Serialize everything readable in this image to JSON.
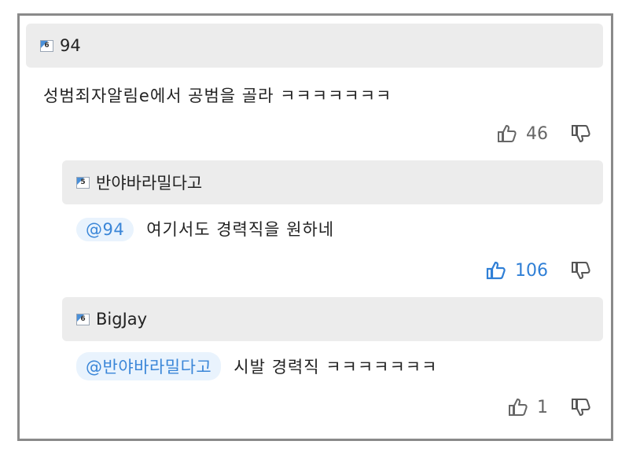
{
  "comments": [
    {
      "level": "6",
      "nickname": "94",
      "mention": "",
      "text": "성범죄자알림e에서 공범을 골라 ㅋㅋㅋㅋㅋㅋㅋ",
      "likes": "46",
      "liked": false
    },
    {
      "level": "5",
      "nickname": "반야바라밀다고",
      "mention": "@94",
      "text": "여기서도 경력직을 원하네",
      "likes": "106",
      "liked": true
    },
    {
      "level": "6",
      "nickname": "BigJay",
      "mention": "@반야바라밀다고",
      "text": "시발 경력직 ㅋㅋㅋㅋㅋㅋㅋ",
      "likes": "1",
      "liked": false
    }
  ],
  "icons": {
    "like": "thumbs-up-icon",
    "dislike": "thumbs-down-icon",
    "level": "level-badge-icon"
  },
  "colors": {
    "accent": "#2f7fd6",
    "header_bg": "#ececec",
    "mention_bg": "#e9f3fd",
    "border": "#8a8a8a"
  }
}
